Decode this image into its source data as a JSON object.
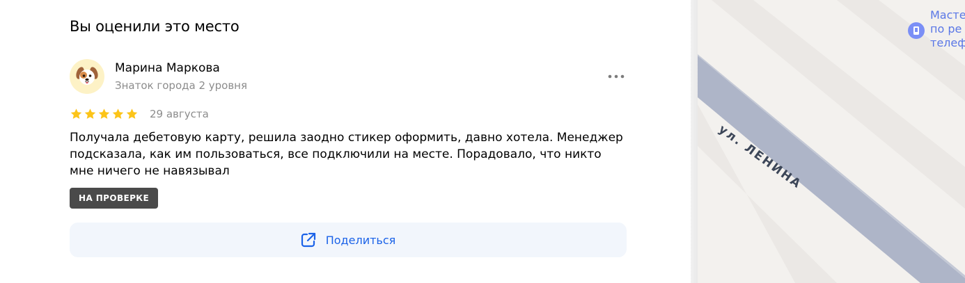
{
  "section": {
    "title": "Вы оценили это место"
  },
  "review": {
    "author": {
      "name": "Марина Маркова",
      "level": "Знаток города 2 уровня",
      "avatar_icon": "dog-face-icon"
    },
    "rating": 5,
    "rating_max": 5,
    "date": "29 августа",
    "text": "Получала дебетовую карту, решила заодно стикер оформить, давно хотела. Менеджер подсказала, как им пользоваться, все подключили на месте. Порадовало, что никто мне ничего не навязывал",
    "status_badge": "НА ПРОВЕРКЕ",
    "more_icon": "more-dots-icon"
  },
  "share": {
    "label": "Поделиться",
    "icon": "share-icon"
  },
  "map": {
    "street_label": "ул. ЛЕНИНА",
    "poi": {
      "label_lines": [
        "Масте",
        "по ре",
        "телеф"
      ],
      "icon": "repair-place-icon"
    }
  },
  "colors": {
    "accent": "#1a62e8",
    "star": "#fcc419",
    "badge_bg": "#4a4a4a",
    "share_bg": "#f2f6fc",
    "street": "#aeb5c8",
    "poi": "#7b8ff6"
  }
}
